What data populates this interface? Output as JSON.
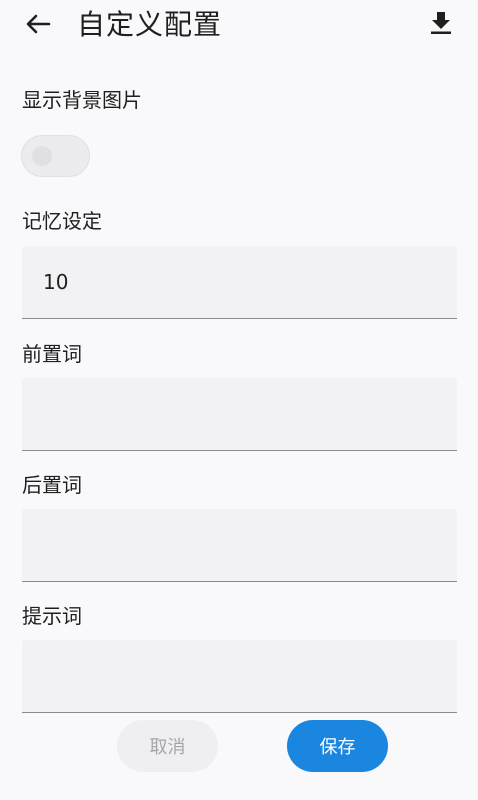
{
  "header": {
    "title": "自定义配置",
    "back_icon": "arrow-back-icon",
    "download_icon": "download-icon"
  },
  "settings": {
    "show_background": {
      "label": "显示背景图片",
      "enabled": false
    },
    "memory": {
      "label": "记忆设定",
      "value": "10"
    },
    "prefix": {
      "label": "前置词",
      "value": ""
    },
    "suffix": {
      "label": "后置词",
      "value": ""
    },
    "prompt": {
      "label": "提示词",
      "value": ""
    }
  },
  "actions": {
    "cancel_label": "取消",
    "save_label": "保存"
  },
  "colors": {
    "background": "#f9f9fb",
    "field_background": "#f2f2f4",
    "primary": "#1a86e0",
    "text": "#1f1f1f",
    "disabled_text": "#a5a5a8"
  }
}
